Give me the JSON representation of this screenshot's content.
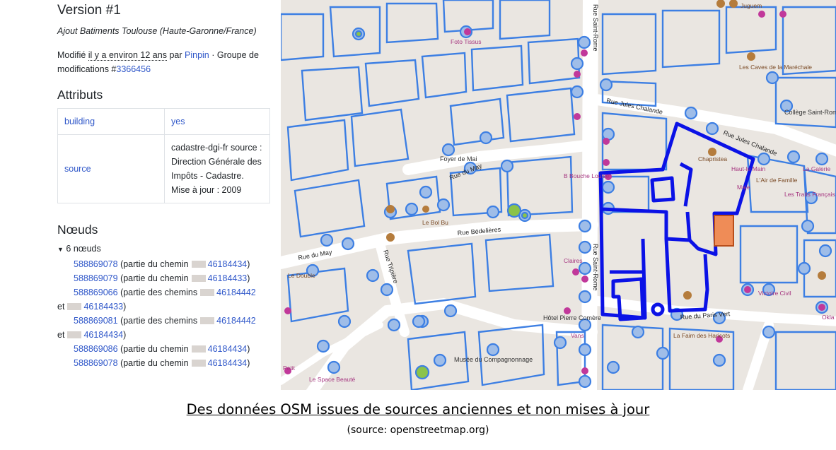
{
  "panel": {
    "version_title": "Version #1",
    "changeset_comment": "Ajout Batiments Toulouse (Haute-Garonne/France)",
    "meta": {
      "modified_prefix": "Modifié",
      "time_ago": "il y a environ 12 ans",
      "by_label": "par",
      "user": "Pinpin",
      "changeset_prefix": "· Groupe de modifications #",
      "changeset_id": "3366456"
    },
    "attributes_heading": "Attributs",
    "tags": [
      {
        "key": "building",
        "value": "yes"
      },
      {
        "key": "source",
        "value": "cadastre-dgi-fr source : Direction Générale des Impôts - Cadastre. Mise à jour : 2009"
      }
    ],
    "nodes_heading": "Nœuds",
    "nodes_summary": "6 nœuds",
    "nodes": [
      {
        "id": "588869078",
        "text": "(partie du chemin",
        "way": "46184434",
        "close": ")"
      },
      {
        "id": "588869079",
        "text": "(partie du chemin",
        "way": "46184433",
        "close": ")"
      },
      {
        "id": "588869066",
        "text": "(partie des chemins",
        "way": "46184442",
        "and": "et",
        "way2": "46184433",
        "close": ")"
      },
      {
        "id": "588869081",
        "text": "(partie des chemins",
        "way": "46184442",
        "and": "et",
        "way2": "46184434",
        "close": ")"
      },
      {
        "id": "588869086",
        "text": "(partie du chemin",
        "way": "46184434",
        "close": ")"
      },
      {
        "id": "588869078",
        "text": "(partie du chemin",
        "way": "46184434",
        "close": ")"
      }
    ]
  },
  "map": {
    "streets": {
      "rue_du_may_1": "Rue du May",
      "rue_du_may_2": "Rue du May",
      "rue_bedelieres": "Rue Bédelières",
      "rue_tripiere": "Rue Tripière",
      "rue_saint_rome": "Rue Saint-Rome",
      "rue_jules_chalande": "Rue Jules Chalande",
      "rue_des_paris_vert": "Rue du Paris Vert"
    },
    "places": {
      "college": "Collège Saint-Rome",
      "hotel": "Hôtel Pierre Comère",
      "musee": "Musée du Compagnonnage",
      "foyer": "Foyer de Mai",
      "les_caves": "Les Caves de la Maréchale",
      "juguem": "Juguem",
      "chapristea": "Chapristea",
      "haut_le_main": "Haut-le Main",
      "air_de_famille": "L'Air de Famille",
      "la_galerie": "La Galerie",
      "les_traits": "Les Traits Français",
      "le_double": "Le Double",
      "le_bol_bu": "Le Bol Bu",
      "la_faim": "La Faim des Haricots",
      "okla": "Okla",
      "vans": "Vans",
      "le_space": "Le Space Beauté",
      "petit": "Petit",
      "foto_tissus": "Foto Tissus",
      "bouche": "B Bouche Louise",
      "claires": "Claires",
      "manor": "Maje",
      "civil": "Victoire Civil"
    },
    "accent_building_color": "#0b12e6",
    "highlight_building_color": "#ef8c57",
    "outline_color": "#3d7fe3"
  },
  "caption": {
    "title": "Des données OSM issues de sources anciennes et non mises à jour",
    "source": "(source: openstreetmap.org)"
  }
}
